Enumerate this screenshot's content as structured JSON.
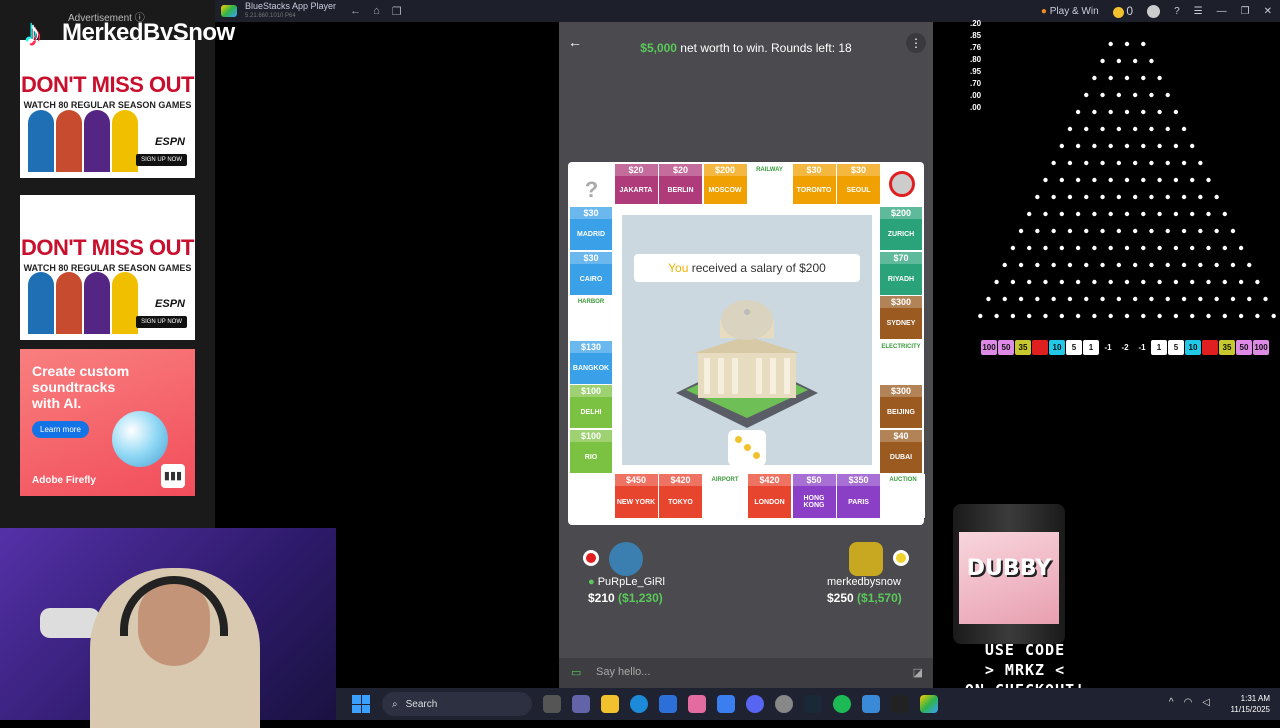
{
  "window": {
    "app_title": "BlueStacks App Player",
    "app_version": "5.21.660.1010 P64",
    "play_win": "Play & Win",
    "coins": "0"
  },
  "overlay": {
    "advertisement_label": "Advertisement ⓘ",
    "streamer_name": "MerkedBySnow"
  },
  "ads": {
    "espn_headline": "DON'T MISS OUT",
    "espn_sub": "WATCH 80 REGULAR SEASON GAMES",
    "espn_brand": "ESPN",
    "espn_cta": "SIGN UP NOW",
    "adobe_headline": "Create custom soundtracks with AI.",
    "adobe_cta": "Learn more",
    "adobe_brand": "Adobe Firefly"
  },
  "game": {
    "goal_amount": "$5,000",
    "goal_text": " net worth to win. Rounds left: 18",
    "message_you": "You",
    "message_text": " received a salary of $200",
    "top_row": [
      {
        "price": "",
        "name": "?",
        "color": "#ffffff"
      },
      {
        "price": "$20",
        "name": "JAKARTA",
        "color": "#b03b7a"
      },
      {
        "price": "$20",
        "name": "BERLIN",
        "color": "#b03b7a"
      },
      {
        "price": "$200",
        "name": "MOSCOW",
        "color": "#f0a000"
      },
      {
        "price": "RAILWAY",
        "name": "",
        "color": "#ffffff"
      },
      {
        "price": "$30",
        "name": "TORONTO",
        "color": "#f0a000"
      },
      {
        "price": "$30",
        "name": "SEOUL",
        "color": "#f0a000"
      }
    ],
    "left_col": [
      {
        "price": "$30",
        "name": "MADRID",
        "color": "#3aa0e8"
      },
      {
        "price": "$30",
        "name": "CAIRO",
        "color": "#3aa0e8"
      },
      {
        "price": "HARBOR",
        "name": "",
        "color": "#ffffff"
      },
      {
        "price": "$130",
        "name": "BANGKOK",
        "color": "#3aa0e8"
      },
      {
        "price": "$100",
        "name": "DELHI",
        "color": "#7cc242"
      },
      {
        "price": "$100",
        "name": "RIO",
        "color": "#7cc242"
      }
    ],
    "right_col": [
      {
        "price": "$200",
        "name": "ZURICH",
        "color": "#2aa37a"
      },
      {
        "price": "$70",
        "name": "RIYADH",
        "color": "#2aa37a"
      },
      {
        "price": "$300",
        "name": "SYDNEY",
        "color": "#9a5a20"
      },
      {
        "price": "ELECTRICITY",
        "name": "",
        "color": "#ffffff"
      },
      {
        "price": "$300",
        "name": "BEIJING",
        "color": "#9a5a20"
      },
      {
        "price": "$40",
        "name": "DUBAI",
        "color": "#9a5a20"
      }
    ],
    "bottom_row": [
      {
        "price": "",
        "name": "",
        "color": "#ffffff"
      },
      {
        "price": "$450",
        "name": "NEW YORK",
        "color": "#e8452e"
      },
      {
        "price": "$420",
        "name": "TOKYO",
        "color": "#e8452e"
      },
      {
        "price": "AIRPORT",
        "name": "",
        "color": "#ffffff"
      },
      {
        "price": "$420",
        "name": "LONDON",
        "color": "#e8452e"
      },
      {
        "price": "$50",
        "name": "HONG KONG",
        "color": "#8b3fc7"
      },
      {
        "price": "$350",
        "name": "PARIS",
        "color": "#8b3fc7"
      },
      {
        "price": "AUCTION",
        "name": "",
        "color": "#ffffff"
      }
    ],
    "player1": {
      "name": "PuRpLe_GiRl",
      "cash": "$210",
      "worth": "($1,230)"
    },
    "player2": {
      "name": "merkedbysnow",
      "cash": "$250",
      "worth": "($1,570)"
    },
    "chat_placeholder": "Say hello..."
  },
  "plinko": {
    "multipliers_list": [
      ".20",
      ".85",
      ".76",
      ".80",
      ".95",
      ".70",
      ".00",
      ".00"
    ],
    "buckets": [
      {
        "label": "100",
        "color": "#e08ae8"
      },
      {
        "label": "50",
        "color": "#e08ae8"
      },
      {
        "label": "35",
        "color": "#c8c830"
      },
      {
        "label": "10",
        "color": "#e02020"
      },
      {
        "label": "10",
        "color": "#22c8e8"
      },
      {
        "label": "5",
        "color": "#ffffff"
      },
      {
        "label": "1",
        "color": "#ffffff"
      },
      {
        "label": "-1",
        "color": "#000000"
      },
      {
        "label": "-2",
        "color": "#000000"
      },
      {
        "label": "-1",
        "color": "#000000"
      },
      {
        "label": "1",
        "color": "#ffffff"
      },
      {
        "label": "5",
        "color": "#ffffff"
      },
      {
        "label": "10",
        "color": "#22c8e8"
      },
      {
        "label": "10",
        "color": "#e02020"
      },
      {
        "label": "35",
        "color": "#c8c830"
      },
      {
        "label": "50",
        "color": "#e08ae8"
      },
      {
        "label": "100",
        "color": "#e08ae8"
      }
    ]
  },
  "promo": {
    "can_brand": "DUBBY",
    "line1": "USE CODE",
    "line2": "> MRKZ <",
    "line3": "ON CHECKOUT!"
  },
  "taskbar": {
    "search": "Search",
    "time": "1:31 AM",
    "date": "11/15/2025"
  }
}
